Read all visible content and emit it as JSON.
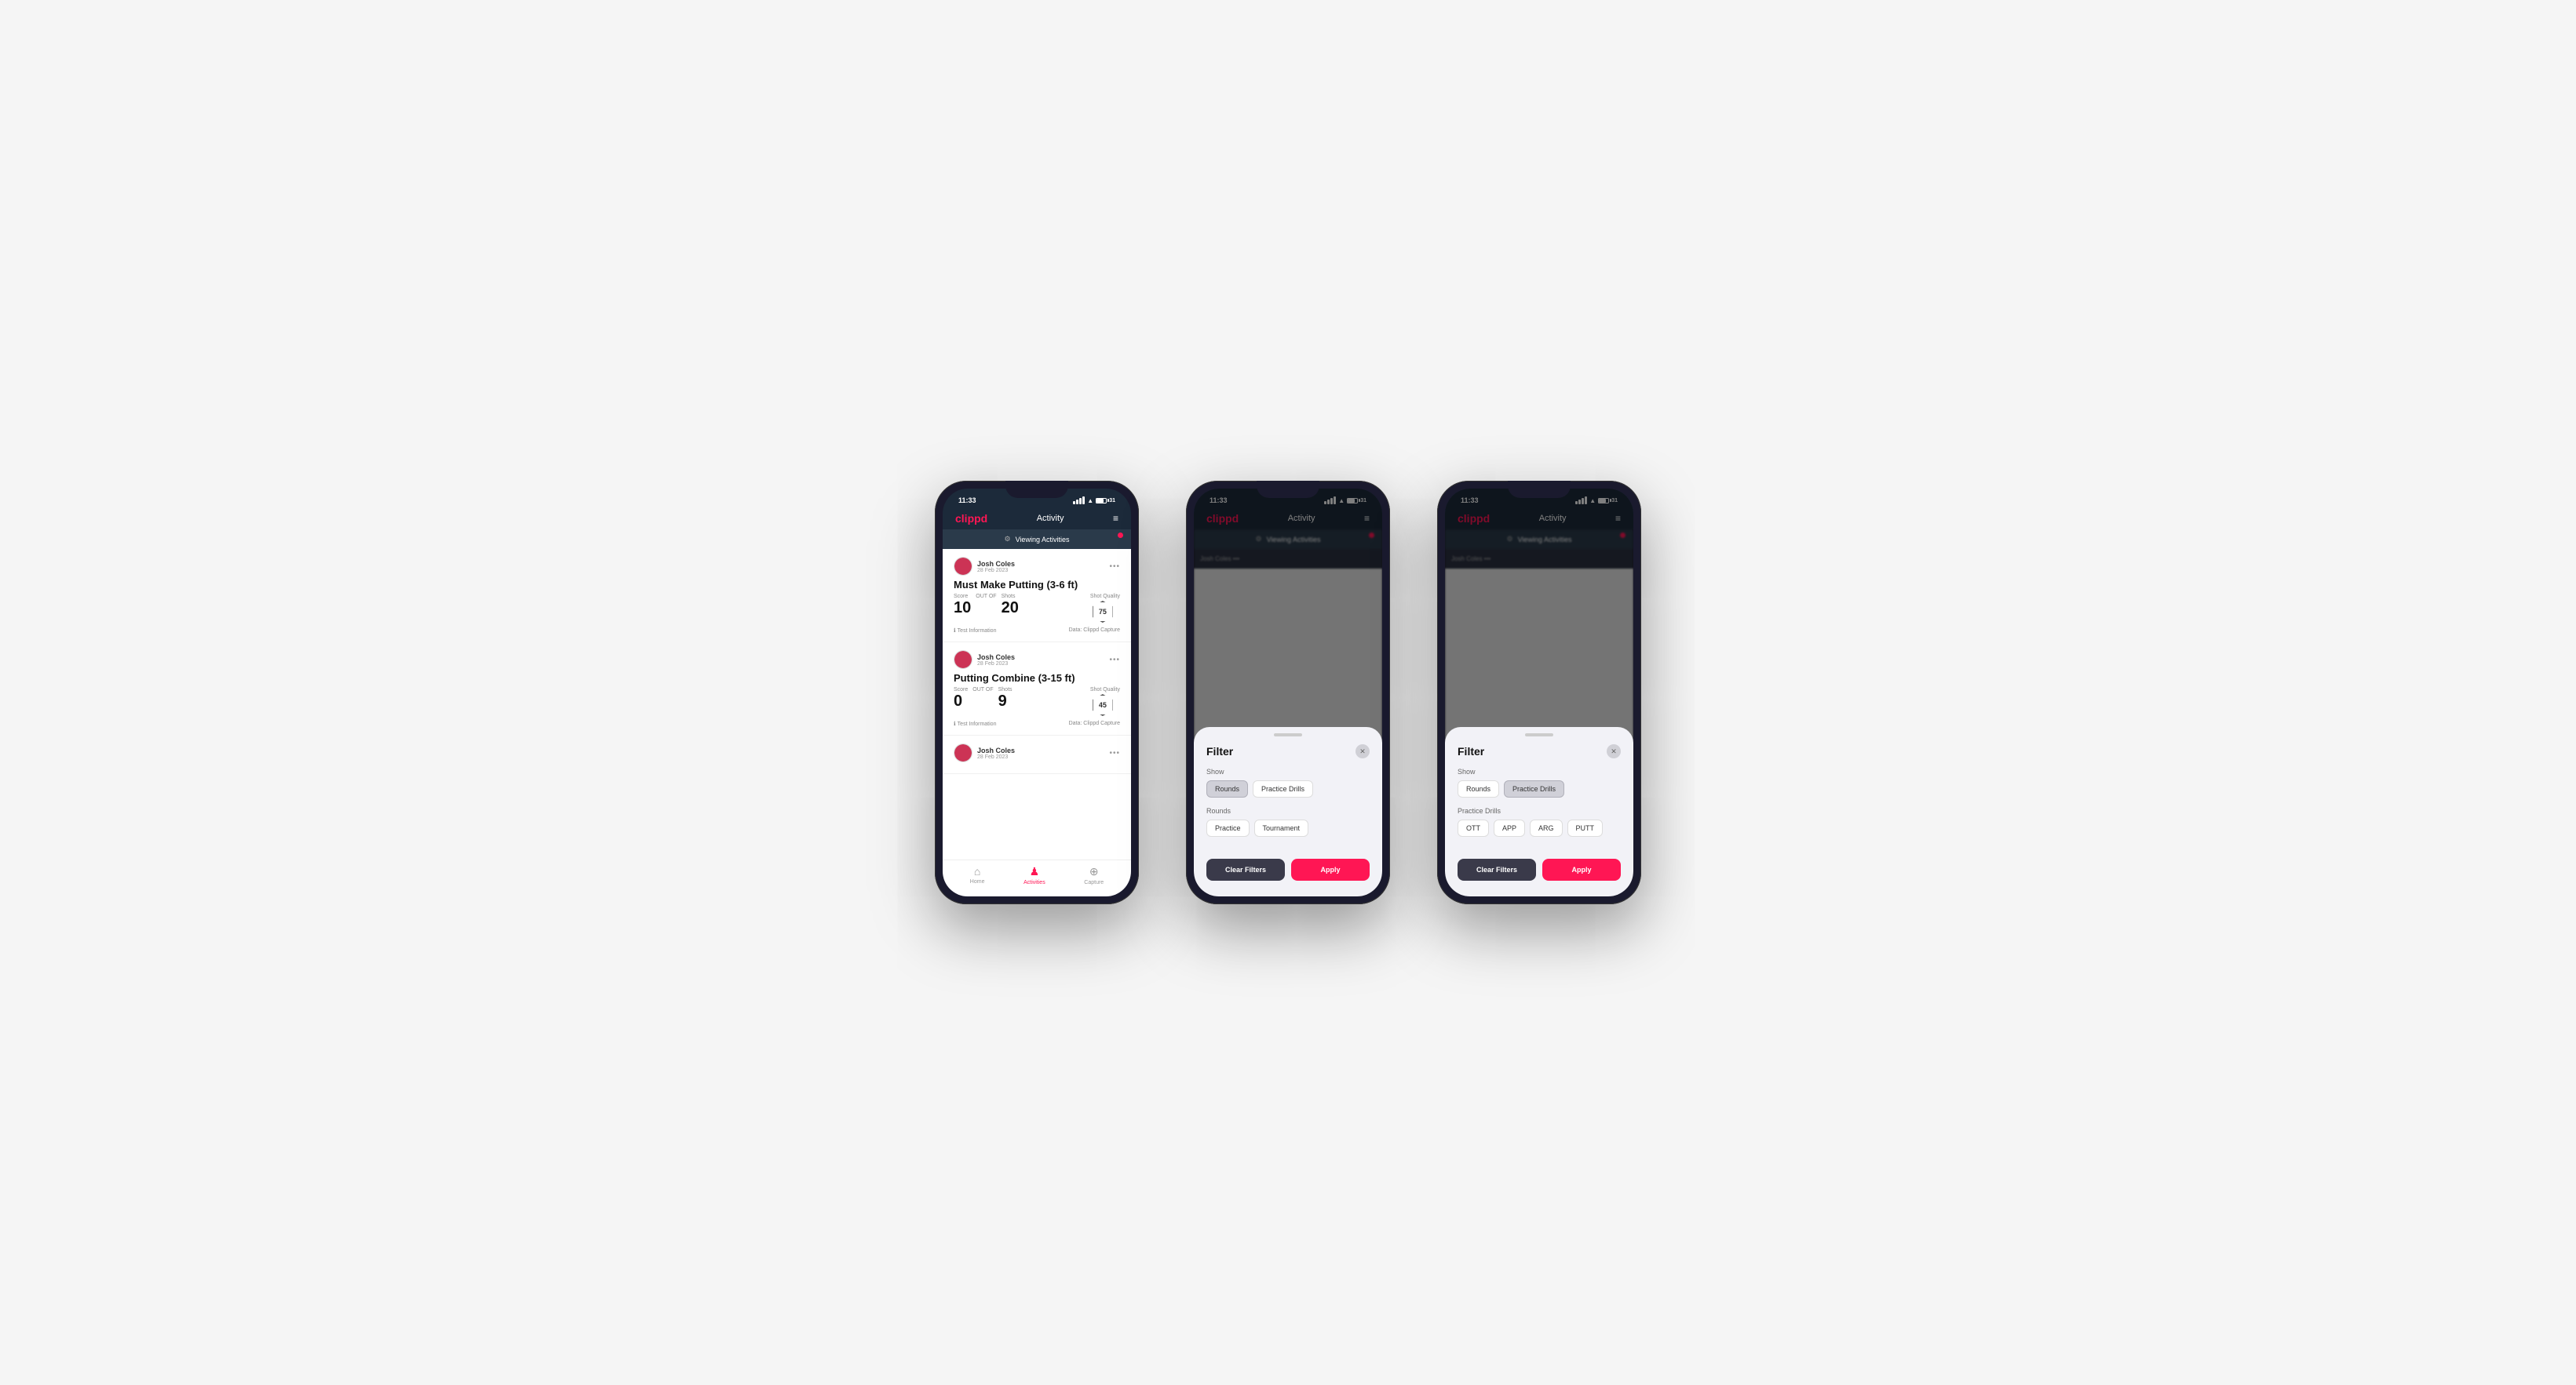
{
  "colors": {
    "accent": "#ff1654",
    "dark_bg": "#1c2a3a",
    "card_bg": "#ffffff",
    "header_bg": "#1c2a3a",
    "filter_bg": "#f2f2f7"
  },
  "phones": [
    {
      "id": "phone1",
      "status_bar": {
        "time": "11:33",
        "battery": "31"
      },
      "header": {
        "logo": "clippd",
        "title": "Activity",
        "menu_icon": "≡"
      },
      "viewing_bar": {
        "label": "Viewing Activities",
        "has_dot": true
      },
      "activities": [
        {
          "user": "Josh Coles",
          "date": "28 Feb 2023",
          "title": "Must Make Putting (3-6 ft)",
          "score_label": "Score",
          "score": "10",
          "shots_label": "Shots",
          "shots": "20",
          "sq_label": "Shot Quality",
          "sq": "75",
          "test_info": "Test Information",
          "data_source": "Data: Clippd Capture"
        },
        {
          "user": "Josh Coles",
          "date": "28 Feb 2023",
          "title": "Putting Combine (3-15 ft)",
          "score_label": "Score",
          "score": "0",
          "shots_label": "Shots",
          "shots": "9",
          "sq_label": "Shot Quality",
          "sq": "45",
          "test_info": "Test Information",
          "data_source": "Data: Clippd Capture"
        },
        {
          "user": "Josh Coles",
          "date": "28 Feb 2023",
          "title": "",
          "score_label": "",
          "score": "",
          "shots_label": "",
          "shots": "",
          "sq_label": "",
          "sq": "",
          "test_info": "",
          "data_source": ""
        }
      ],
      "nav": {
        "items": [
          {
            "icon": "🏠",
            "label": "Home",
            "active": false
          },
          {
            "icon": "👤",
            "label": "Activities",
            "active": true
          },
          {
            "icon": "➕",
            "label": "Capture",
            "active": false
          }
        ]
      },
      "show_filter": false
    },
    {
      "id": "phone2",
      "status_bar": {
        "time": "11:33",
        "battery": "31"
      },
      "header": {
        "logo": "clippd",
        "title": "Activity",
        "menu_icon": "≡"
      },
      "viewing_bar": {
        "label": "Viewing Activities",
        "has_dot": true
      },
      "show_filter": true,
      "filter": {
        "title": "Filter",
        "show_label": "Show",
        "show_chips": [
          {
            "label": "Rounds",
            "active": true
          },
          {
            "label": "Practice Drills",
            "active": false
          }
        ],
        "rounds_label": "Rounds",
        "rounds_chips": [
          {
            "label": "Practice",
            "active": false
          },
          {
            "label": "Tournament",
            "active": false
          }
        ],
        "practice_drills_label": null,
        "practice_drills_chips": null,
        "clear_label": "Clear Filters",
        "apply_label": "Apply"
      }
    },
    {
      "id": "phone3",
      "status_bar": {
        "time": "11:33",
        "battery": "31"
      },
      "header": {
        "logo": "clippd",
        "title": "Activity",
        "menu_icon": "≡"
      },
      "viewing_bar": {
        "label": "Viewing Activities",
        "has_dot": true
      },
      "show_filter": true,
      "filter": {
        "title": "Filter",
        "show_label": "Show",
        "show_chips": [
          {
            "label": "Rounds",
            "active": false
          },
          {
            "label": "Practice Drills",
            "active": true
          }
        ],
        "rounds_label": null,
        "rounds_chips": null,
        "practice_drills_label": "Practice Drills",
        "practice_drills_chips": [
          {
            "label": "OTT",
            "active": false
          },
          {
            "label": "APP",
            "active": false
          },
          {
            "label": "ARG",
            "active": false
          },
          {
            "label": "PUTT",
            "active": false
          }
        ],
        "clear_label": "Clear Filters",
        "apply_label": "Apply"
      }
    }
  ]
}
